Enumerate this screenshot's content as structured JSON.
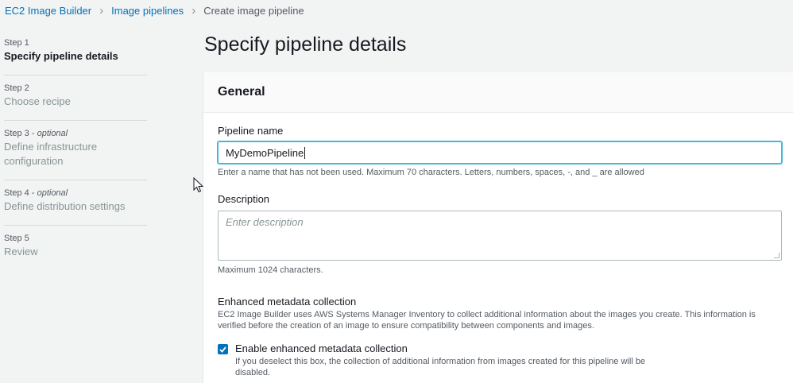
{
  "breadcrumb": {
    "items": [
      "EC2 Image Builder",
      "Image pipelines"
    ],
    "current": "Create image pipeline"
  },
  "steps": [
    {
      "num": "Step 1",
      "optional": "",
      "title": "Specify pipeline details",
      "active": true
    },
    {
      "num": "Step 2",
      "optional": "",
      "title": "Choose recipe"
    },
    {
      "num": "Step 3 - ",
      "optional": "optional",
      "title": "Define infrastructure configuration"
    },
    {
      "num": "Step 4 - ",
      "optional": "optional",
      "title": "Define distribution settings"
    },
    {
      "num": "Step 5",
      "optional": "",
      "title": "Review"
    }
  ],
  "page_title": "Specify pipeline details",
  "panel": {
    "title": "General",
    "pipeline_name": {
      "label": "Pipeline name",
      "value": "MyDemoPipeline",
      "hint": "Enter a name that has not been used. Maximum 70 characters. Letters, numbers, spaces, -, and _ are allowed"
    },
    "description": {
      "label": "Description",
      "placeholder": "Enter description",
      "hint": "Maximum 1024 characters."
    },
    "metadata": {
      "title": "Enhanced metadata collection",
      "description": "EC2 Image Builder uses AWS Systems Manager Inventory to collect additional information about the images you create. This information is verified before the creation of an image to ensure compatibility between components and images.",
      "checkbox_label": "Enable enhanced metadata collection",
      "checkbox_desc": "If you deselect this box, the collection of additional information from images created for this pipeline will be disabled.",
      "checked": true
    }
  },
  "colors": {
    "link": "#0073bb",
    "focus": "#44b9d6",
    "background": "#f2f3f3"
  },
  "icons": {
    "separator": "chevron-right-icon",
    "check": "checkmark-icon",
    "cursor": "mouse-pointer-icon"
  }
}
